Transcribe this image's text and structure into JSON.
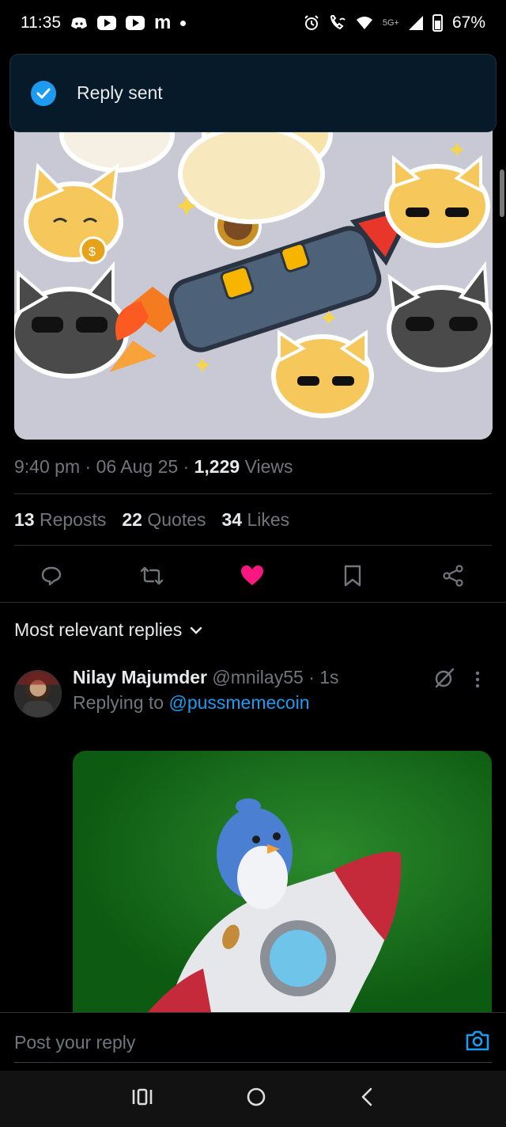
{
  "status_bar": {
    "time": "11:35",
    "network": "5G+",
    "battery": "67%",
    "m_glyph": "m"
  },
  "toast": {
    "text": "Reply sent",
    "icon": "check-circle-icon",
    "accent": "#1d9bf0"
  },
  "tweet": {
    "time": "9:40 pm",
    "date": "06 Aug 25",
    "views_count": "1,229",
    "views_label": "Views",
    "reposts_count": "13",
    "reposts_label": "Reposts",
    "quotes_count": "22",
    "quotes_label": "Quotes",
    "likes_count": "34",
    "likes_label": "Likes",
    "liked": true,
    "like_color": "#f91880"
  },
  "sort": {
    "label": "Most relevant replies"
  },
  "reply": {
    "display_name": "Nilay Majumder",
    "handle": "@mnilay55",
    "age": "1s",
    "replying_prefix": "Replying to",
    "replying_to": "@pussmemecoin"
  },
  "compose": {
    "placeholder": "Post your reply"
  },
  "colors": {
    "background": "#000000",
    "text_primary": "#e7e9ea",
    "text_secondary": "#71767b",
    "link": "#1d9bf0"
  }
}
